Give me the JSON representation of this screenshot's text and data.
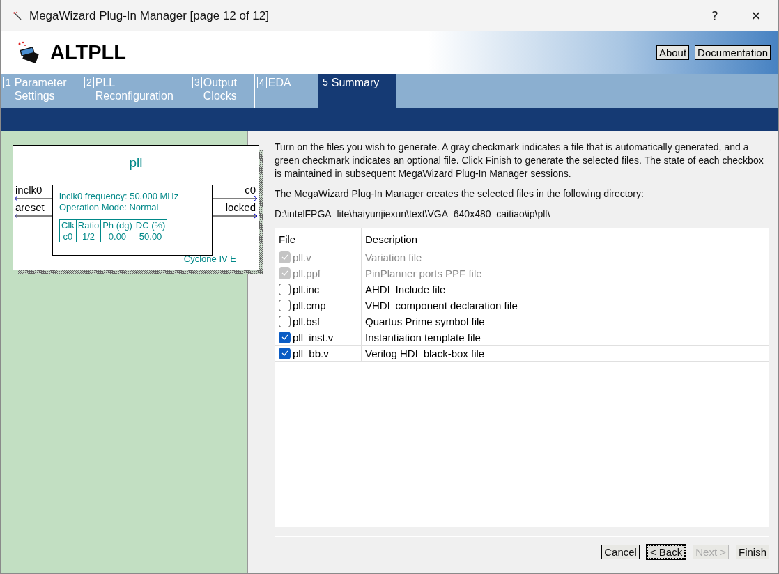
{
  "window": {
    "title": "MegaWizard Plug-In Manager [page 12 of 12]",
    "help": "?",
    "close": "✕"
  },
  "header": {
    "title": "ALTPLL",
    "buttons": [
      "About",
      "Documentation"
    ]
  },
  "tabs": [
    {
      "number": "1",
      "lines": [
        "Parameter",
        "Settings"
      ],
      "selected": false
    },
    {
      "number": "2",
      "lines": [
        "PLL",
        "Reconfiguration"
      ],
      "selected": false
    },
    {
      "number": "3",
      "lines": [
        "Output",
        "Clocks"
      ],
      "selected": false
    },
    {
      "number": "4",
      "lines": [
        "EDA"
      ],
      "selected": false
    },
    {
      "number": "5",
      "lines": [
        "Summary"
      ],
      "selected": true
    }
  ],
  "diagram": {
    "name": "pll",
    "inputs": [
      "inclk0",
      "areset"
    ],
    "outputs": [
      "c0",
      "locked"
    ],
    "info": [
      "inclk0 frequency: 50.000 MHz",
      "Operation Mode: Normal"
    ],
    "clock_table": {
      "columns": [
        "Clk",
        "Ratio",
        "Ph (dg)",
        "DC (%)"
      ],
      "rows": [
        [
          "c0",
          "1/2",
          "0.00",
          "50.00"
        ]
      ]
    },
    "device": "Cyclone IV E"
  },
  "intro": "Turn on the files you wish to generate. A gray checkmark indicates a file that is automatically generated, and a green checkmark indicates an optional file. Click Finish to generate the selected files. The state of each checkbox is maintained in subsequent MegaWizard Plug-In Manager sessions.",
  "directory_note": "The MegaWizard Plug-In Manager creates the selected files in the following directory:",
  "directory": "D:\\intelFPGA_lite\\haiyunjiexun\\text\\VGA_640x480_caitiao\\ip\\pll\\",
  "files": {
    "columns": [
      "File",
      "Description"
    ],
    "rows": [
      {
        "name": "pll.v",
        "description": "Variation file",
        "checked": true,
        "disabled": true
      },
      {
        "name": "pll.ppf",
        "description": "PinPlanner ports PPF file",
        "checked": true,
        "disabled": true
      },
      {
        "name": "pll.inc",
        "description": "AHDL Include file",
        "checked": false,
        "disabled": false
      },
      {
        "name": "pll.cmp",
        "description": "VHDL component declaration file",
        "checked": false,
        "disabled": false
      },
      {
        "name": "pll.bsf",
        "description": "Quartus Prime symbol file",
        "checked": false,
        "disabled": false
      },
      {
        "name": "pll_inst.v",
        "description": "Instantiation template file",
        "checked": true,
        "disabled": false
      },
      {
        "name": "pll_bb.v",
        "description": "Verilog HDL black-box file",
        "checked": true,
        "disabled": false
      }
    ]
  },
  "buttons": [
    {
      "label": "Cancel",
      "disabled": false,
      "focused": false
    },
    {
      "label": "< Back",
      "disabled": false,
      "focused": true
    },
    {
      "label": "Next >",
      "disabled": true,
      "focused": false
    },
    {
      "label": "Finish",
      "disabled": false,
      "focused": false
    }
  ]
}
